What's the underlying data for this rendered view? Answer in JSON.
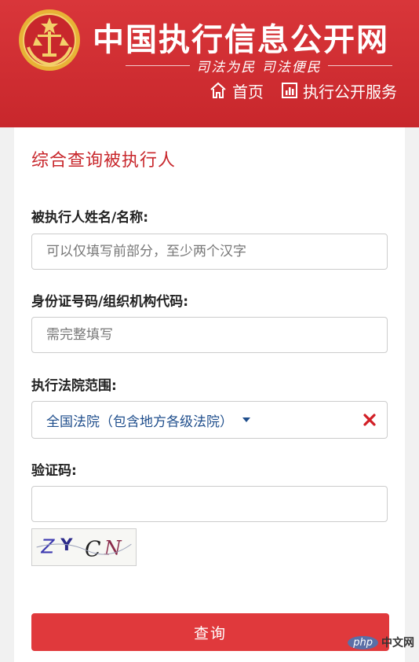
{
  "header": {
    "site_title": "中国执行信息公开网",
    "slogan": "司法为民   司法便民",
    "nav": [
      {
        "label": "首页",
        "icon": "home-icon"
      },
      {
        "label": "执行公开服务",
        "icon": "bar-chart-icon"
      }
    ]
  },
  "form": {
    "title": "综合查询被执行人",
    "name_label": "被执行人姓名/名称:",
    "name_placeholder": "可以仅填写前部分，至少两个汉字",
    "name_value": "",
    "id_label": "身份证号码/组织机构代码:",
    "id_placeholder": "需完整填写",
    "id_value": "",
    "court_label": "执行法院范围:",
    "court_selected": "全国法院（包含地方各级法院）",
    "captcha_label": "验证码:",
    "captcha_value": "",
    "captcha_image_text": "ZYCN",
    "submit_label": "查询"
  },
  "watermark": {
    "logo": "php",
    "text": "中文网"
  },
  "colors": {
    "brand_red": "#c8272c",
    "button_red": "#e0393c",
    "select_blue": "#1f4e8c"
  }
}
